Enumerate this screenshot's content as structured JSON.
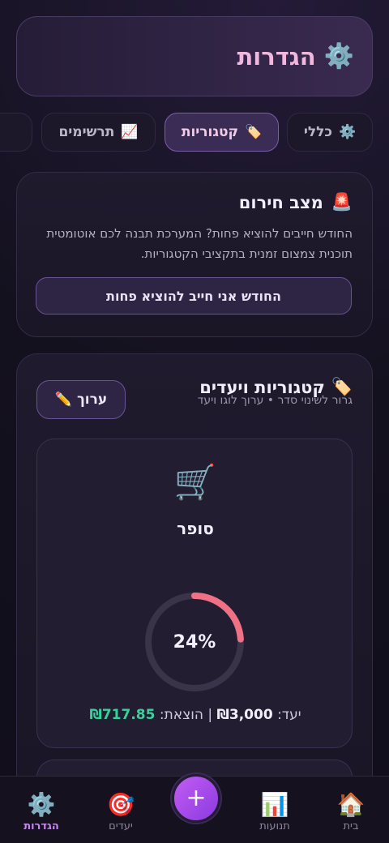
{
  "header": {
    "icon": "gear-icon",
    "icon_glyph": "⚙️",
    "title": "הגדרות"
  },
  "tabs": [
    {
      "label": "כללי",
      "icon": "gear-icon",
      "glyph": "⚙️",
      "active": false
    },
    {
      "label": "קטגוריות",
      "icon": "tag-icon",
      "glyph": "🏷️",
      "active": true
    },
    {
      "label": "תרשימים",
      "icon": "chart-icon",
      "glyph": "📈",
      "active": false
    }
  ],
  "emergency": {
    "icon": "siren-icon",
    "glyph": "🚨",
    "title": "מצב חירום",
    "description": "החודש חייבים להוציא פחות? המערכת תבנה לכם אוטומטית תוכנית צמצום זמנית בתקציבי הקטגוריות.",
    "button_label": "החודש אני חייב להוציא פחות"
  },
  "categories": {
    "icon": "tag-icon",
    "glyph": "🏷️",
    "title": "קטגוריות ויעדים",
    "subtitle": "גרור לשינוי סדר • ערוך לוגו ויעד",
    "edit_label": "ערוך",
    "edit_glyph": "✏️",
    "items": [
      {
        "icon": "shopping-cart-icon",
        "glyph": "🛒",
        "name": "סופר",
        "percent_label": "24%",
        "progress": 0.24,
        "goal_label": "יעד:",
        "goal_value": "₪3,000",
        "separator": "|",
        "spent_label": "הוצאת:",
        "spent_value": "₪717.85"
      }
    ]
  },
  "nav": {
    "items": [
      {
        "label": "בית",
        "icon": "home-icon",
        "glyph": "🏠",
        "active": false
      },
      {
        "label": "תנועות",
        "icon": "bar-chart-icon",
        "glyph": "📊",
        "active": false
      },
      {
        "label": "יעדים",
        "icon": "target-icon",
        "glyph": "🎯",
        "active": false
      },
      {
        "label": "הגדרות",
        "icon": "gear-icon",
        "glyph": "⚙️",
        "active": true
      }
    ],
    "fab_glyph": "+"
  },
  "colors": {
    "accent": "#c35cf3",
    "progress": "#f07085",
    "spent": "#35d39a",
    "header_title": "#f1b7dc"
  }
}
